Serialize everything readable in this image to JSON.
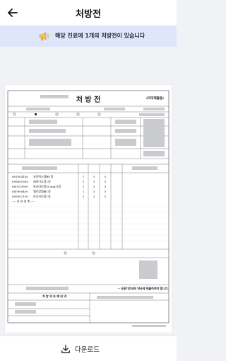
{
  "header": {
    "title": "처방전"
  },
  "banner": {
    "text": "해당 진료에 1개의 처방전이 있습니다"
  },
  "document": {
    "title": "처 방 전",
    "note": "(약국제출용)",
    "medications": [
      {
        "code": "661904140",
        "name": "포모텍스캡슐1정",
        "dose": "1",
        "times": "3",
        "days": "5"
      },
      {
        "code": "698601600",
        "name": "레보디오정1정",
        "dose": "1",
        "times": "3",
        "days": "5"
      },
      {
        "code": "640103600",
        "name": "뮤코라이정(52mg)1정",
        "dose": "1",
        "times": "3",
        "days": "5"
      },
      {
        "code": "640900400",
        "name": "엘로랑캡슐1정",
        "dose": "1",
        "times": "3",
        "days": "5"
      },
      {
        "code": "698902190",
        "name": "라니티딘정1정",
        "dose": "1",
        "times": "3",
        "days": "5"
      }
    ],
    "end_marker": "---- 이 하 여 백 ----",
    "footer_notice": "• 사용기간내에 약국에 제출하여야 합니다.",
    "section_label": "처 방 약 조 제 내 역"
  },
  "footer": {
    "download_label": "다운로드"
  }
}
